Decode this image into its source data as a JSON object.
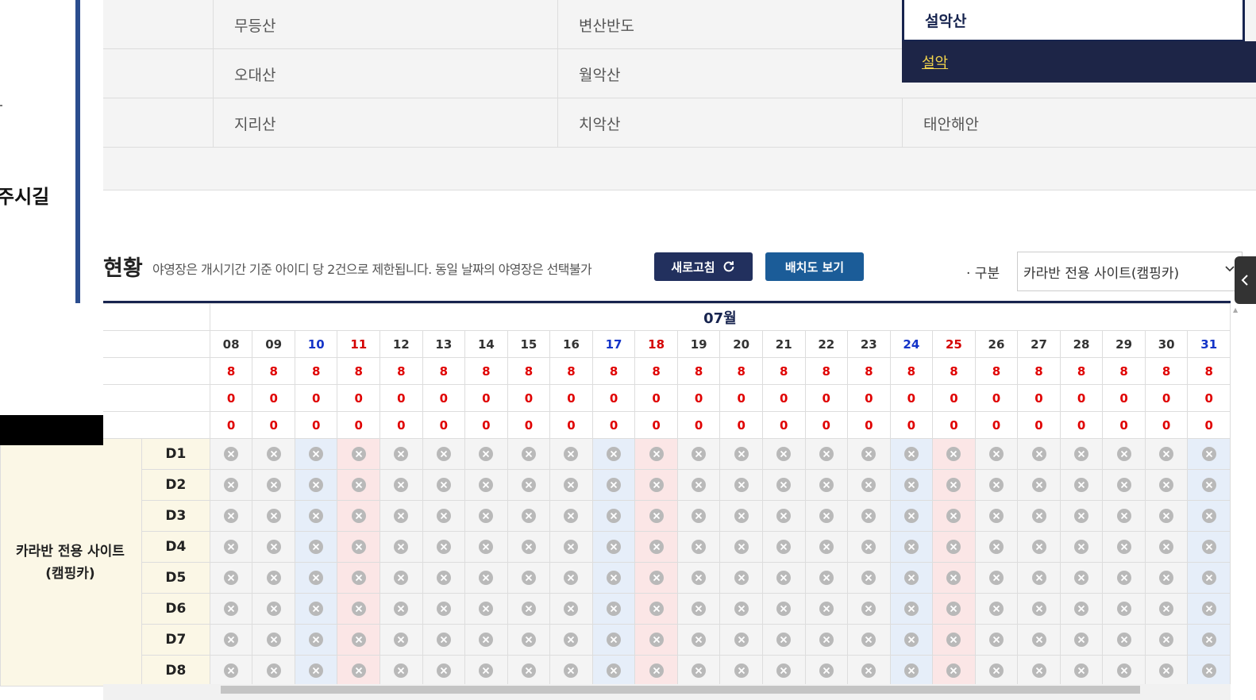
{
  "left": {
    "trail_text": "주시길"
  },
  "parks": [
    [
      "무등산",
      "변산반도",
      "설악산"
    ],
    [
      "오대산",
      "월악산",
      ""
    ],
    [
      "지리산",
      "치악산",
      "태안해안"
    ]
  ],
  "active_park": "설악산",
  "sub_menu": {
    "item": "설악"
  },
  "status": {
    "title": "현황",
    "description": "야영장은 개시기간 기준 아이디 당 2건으로 제한됩니다. 동일 날짜의 야영장은 선택불가",
    "refresh_label": "새로고침",
    "layout_label": "배치도 보기",
    "filter_label": "· 구분",
    "filter_value": "카라반 전용 사이트(캠핑카)"
  },
  "table": {
    "month": "07월",
    "days": [
      "08",
      "09",
      "10",
      "11",
      "12",
      "13",
      "14",
      "15",
      "16",
      "17",
      "18",
      "19",
      "20",
      "21",
      "22",
      "23",
      "24",
      "25",
      "26",
      "27",
      "28",
      "29",
      "30",
      "31"
    ],
    "day_types": [
      "",
      "",
      "sat",
      "sun",
      "",
      "",
      "",
      "",
      "",
      "sat",
      "sun",
      "",
      "",
      "",
      "",
      "",
      "sat",
      "sun",
      "",
      "",
      "",
      "",
      "",
      "sat"
    ],
    "count_rows": [
      [
        "8",
        "8",
        "8",
        "8",
        "8",
        "8",
        "8",
        "8",
        "8",
        "8",
        "8",
        "8",
        "8",
        "8",
        "8",
        "8",
        "8",
        "8",
        "8",
        "8",
        "8",
        "8",
        "8",
        "8"
      ],
      [
        "0",
        "0",
        "0",
        "0",
        "0",
        "0",
        "0",
        "0",
        "0",
        "0",
        "0",
        "0",
        "0",
        "0",
        "0",
        "0",
        "0",
        "0",
        "0",
        "0",
        "0",
        "0",
        "0",
        "0"
      ],
      [
        "0",
        "0",
        "0",
        "0",
        "0",
        "0",
        "0",
        "0",
        "0",
        "0",
        "0",
        "0",
        "0",
        "0",
        "0",
        "0",
        "0",
        "0",
        "0",
        "0",
        "0",
        "0",
        "0",
        "0"
      ]
    ],
    "group_label_line1": "카라반 전용 사이트",
    "group_label_line2": "(캠핑카)",
    "sites": [
      "D1",
      "D2",
      "D3",
      "D4",
      "D5",
      "D6",
      "D7",
      "D8"
    ],
    "cell_status_icon": "x-circle-icon",
    "colors": {
      "saturday_bg": "#e6eef9",
      "sunday_bg": "#fbe6e6",
      "count_color": "#e00000",
      "group_bg": "#fbf7e6",
      "navy": "#17244f"
    }
  }
}
